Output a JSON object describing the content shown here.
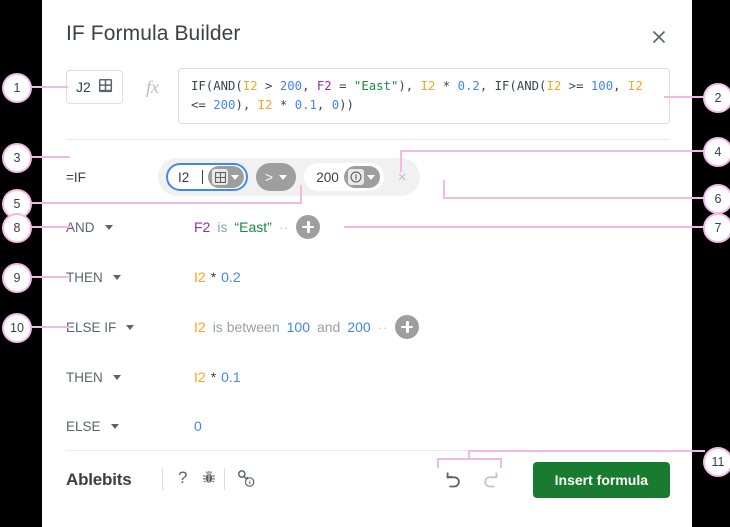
{
  "dialog": {
    "title": "IF Formula Builder",
    "close_icon": "close-icon"
  },
  "formula_bar": {
    "cell_reference": "J2",
    "range_picker_icon": "grid-icon",
    "fx_label": "fx",
    "formula_text": "IF(AND(I2 > 200, F2 = \"East\"), I2 * 0.2, IF(AND(I2 >= 100, I2 <= 200), I2 * 0.1, 0))",
    "formula_tokens": [
      {
        "t": "IF(AND(",
        "c": "plain"
      },
      {
        "t": "I2",
        "c": "ref"
      },
      {
        "t": " > ",
        "c": "plain"
      },
      {
        "t": "200",
        "c": "num"
      },
      {
        "t": ", ",
        "c": "plain"
      },
      {
        "t": "F2",
        "c": "ref2"
      },
      {
        "t": " = ",
        "c": "plain"
      },
      {
        "t": "\"East\"",
        "c": "str"
      },
      {
        "t": "), ",
        "c": "plain"
      },
      {
        "t": "I2",
        "c": "ref"
      },
      {
        "t": " * ",
        "c": "plain"
      },
      {
        "t": "0.2",
        "c": "num"
      },
      {
        "t": ", IF(AND(",
        "c": "plain"
      },
      {
        "t": "I2",
        "c": "ref"
      },
      {
        "t": " >= ",
        "c": "plain"
      },
      {
        "t": "100",
        "c": "num"
      },
      {
        "t": ", ",
        "c": "plain"
      },
      {
        "t": "I2",
        "c": "ref"
      },
      {
        "t": " <= ",
        "c": "plain"
      },
      {
        "t": "200",
        "c": "num"
      },
      {
        "t": "), ",
        "c": "plain"
      },
      {
        "t": "I2",
        "c": "ref"
      },
      {
        "t": " * ",
        "c": "plain"
      },
      {
        "t": "0.1",
        "c": "num"
      },
      {
        "t": ", ",
        "c": "plain"
      },
      {
        "t": "0",
        "c": "num"
      },
      {
        "t": "))",
        "c": "plain"
      }
    ]
  },
  "rows": {
    "if": {
      "label": "=IF",
      "reference_value": "I2",
      "reference_chip_icon": "grid-icon",
      "operator": ">",
      "value": "200",
      "value_chip_icon": "number-info-icon",
      "delete_label": "×"
    },
    "and": {
      "label": "AND",
      "ref": "F2",
      "operator_text": "is",
      "value": "“East”",
      "add_label": "add-condition"
    },
    "then1": {
      "label": "THEN",
      "ref": "I2",
      "op": "*",
      "value": "0.2"
    },
    "elseif": {
      "label": "ELSE IF",
      "ref": "I2",
      "operator_text": "is between",
      "value_low": "100",
      "conjunction": "and",
      "value_high": "200",
      "add_label": "add-condition"
    },
    "then2": {
      "label": "THEN",
      "ref": "I2",
      "op": "*",
      "value": "0.1"
    },
    "else": {
      "label": "ELSE",
      "value": "0"
    }
  },
  "footer": {
    "brand": "Ablebits",
    "help_icon": "question-mark-icon",
    "bug_icon": "bug-icon",
    "support_icon": "key-info-icon",
    "undo_icon": "undo-icon",
    "redo_icon": "redo-icon",
    "insert_label": "Insert formula"
  },
  "callouts": [
    {
      "n": "1"
    },
    {
      "n": "2"
    },
    {
      "n": "3"
    },
    {
      "n": "4"
    },
    {
      "n": "5"
    },
    {
      "n": "6"
    },
    {
      "n": "7"
    },
    {
      "n": "8"
    },
    {
      "n": "9"
    },
    {
      "n": "10"
    },
    {
      "n": "11"
    }
  ],
  "colors": {
    "accent_green": "#197b30",
    "callout_pink": "#f3b8e4",
    "focus_blue": "#4285f4",
    "ref_orange": "#f5a623",
    "string_green": "#1a8a3b",
    "ref_purple": "#9c27b0"
  }
}
